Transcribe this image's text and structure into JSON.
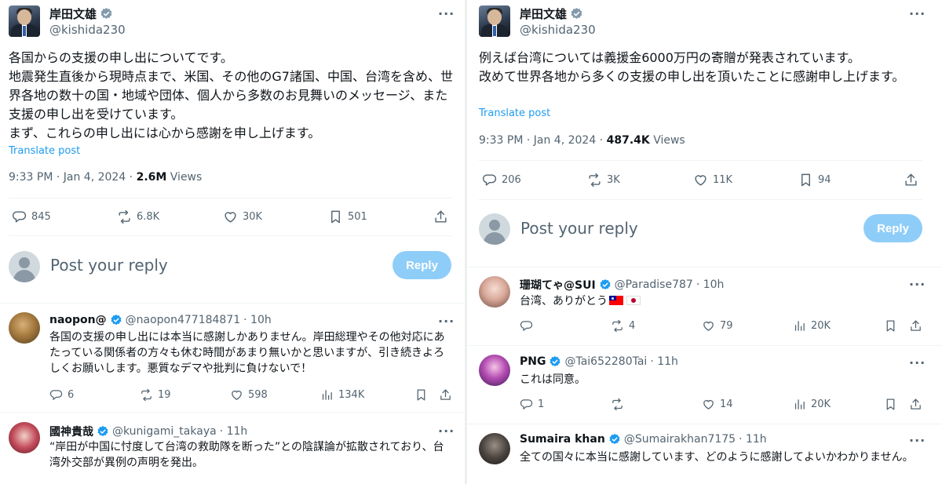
{
  "author": {
    "name": "岸田文雄",
    "handle": "@kishida230"
  },
  "more_glyph": "···",
  "translate_label": "Translate post",
  "views_label": "Views",
  "post_your_reply": "Post your reply",
  "reply_button": "Reply",
  "left": {
    "text": "各国からの支援の申し出についてです。\n地震発生直後から現時点まで、米国、その他のG7諸国、中国、台湾を含め、世界各地の数十の国・地域や団体、個人から多数のお見舞いのメッセージ、また支援の申し出を受けています。\nまず、これらの申し出には心から感謝を申し上げます。",
    "timestamp": "9:33 PM · Jan 4, 2024 · ",
    "views": "2.6M",
    "stats": {
      "replies": "845",
      "reposts": "6.8K",
      "likes": "30K",
      "bookmarks": "501"
    },
    "comments": [
      {
        "name": "naopon@",
        "handle": "@naopon477184871",
        "time": "· 10h",
        "text": "各国の支援の申し出には本当に感謝しかありません。岸田総理やその他対応にあたっている関係者の方々も休む時間があまり無いかと思いますが、引き続きよろしくお願いします。悪質なデマや批判に負けないで！",
        "stats": {
          "replies": "6",
          "reposts": "19",
          "likes": "598",
          "views": "134K"
        }
      },
      {
        "name": "國神貴哉",
        "handle": "@kunigami_takaya",
        "time": "· 11h",
        "text": "“岸田が中国に忖度して台湾の救助隊を断った”との陰謀論が拡散されており、台湾外交部が異例の声明を発出。"
      }
    ]
  },
  "right": {
    "text": "例えば台湾については義援金6000万円の寄贈が発表されています。\n改めて世界各地から多くの支援の申し出を頂いたことに感謝申し上げます。",
    "timestamp": "9:33 PM · Jan 4, 2024 · ",
    "views": "487.4K",
    "stats": {
      "replies": "206",
      "reposts": "3K",
      "likes": "11K",
      "bookmarks": "94"
    },
    "comments": [
      {
        "name": "珊瑚てゃ@SUI",
        "handle": "@Paradise787",
        "time": "· 10h",
        "text": "台湾、ありがとう",
        "stats": {
          "replies": "",
          "reposts": "4",
          "likes": "79",
          "views": "20K"
        }
      },
      {
        "name": "PNG",
        "handle": "@Tai652280Tai",
        "time": "· 11h",
        "text": "これは同意。",
        "stats": {
          "replies": "1",
          "reposts": "",
          "likes": "14",
          "views": "20K"
        }
      },
      {
        "name": "Sumaira khan",
        "handle": "@Sumairakhan7175",
        "time": "· 11h",
        "text": "全ての国々に本当に感謝しています、どのように感謝してよいかわかりません。"
      }
    ]
  },
  "colors": {
    "accent": "#1d9bf0",
    "muted": "#536471",
    "reply_button": "#8ecdf8",
    "verified_blue": "#1d9bf0",
    "verified_gray": "#829aab"
  },
  "icons": [
    "verified-badge-icon",
    "reply-icon",
    "repost-icon",
    "like-icon",
    "bookmark-icon",
    "share-icon",
    "views-icon",
    "more-icon"
  ]
}
